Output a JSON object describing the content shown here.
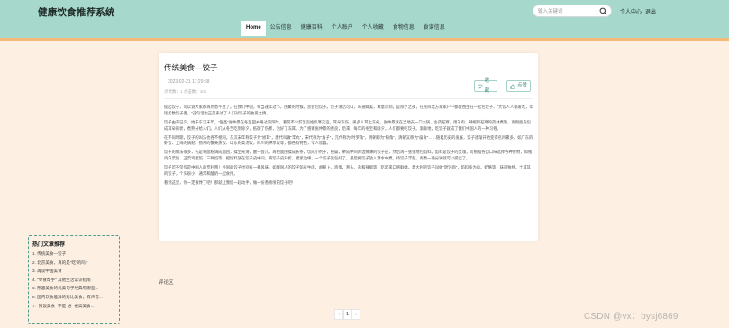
{
  "header": {
    "site_title": "健康饮食推荐系统",
    "search_placeholder": "输入关键词",
    "personal_center": "个人中心",
    "logout": "退出",
    "nav": [
      "Home",
      "公告信息",
      "健康百科",
      "个人账户",
      "个人收藏",
      "食物信息",
      "食谱信息"
    ]
  },
  "article": {
    "title": "传统美食—饺子",
    "date": "2023-02-21 17:29:58",
    "meta": "点赞数：1    点击数：101",
    "collect_label": "收藏",
    "like_label": "点赞",
    "paragraphs": [
      "提起饺子，可以说大家都再熟悉不过了。在我们中国，每当逢年过节，团聚的时候，总会包饺子。饺子清洁可口，味道鲜美，寓意深刻，是除夕之夜，在民间北方家家户户都会围坐在一起包饺子、\"大饺人人都爱吃，年饭尤数饺子香。\"这句话也正是表达了人们对饺子的独爱之情。",
      "饺子由来已久。始于东汉末年。\"医圣\"张仲景在冬至回乡路过南阳时，看见不少贫苦百姓饥寒交迫，耳朵冻伤，很多人耳上冻疮。张仲景就在当地支一口大锅，舍药祛寒。用羊肉、辣椒和祛寒的药材煮熟，再用面皮包成耳朵形状，煮熟分给人们。人们从冬至吃到除夕，抵御了伤寒，治好了冻耳。为了感谢张仲景的善良，后来，每年的冬至和除夕，人们都要吃饺子。渐渐地，吃饺子就成了我们中国人的一种习俗。",
      "在不同时期，饺子的叫法也各不相同。东汉末年称饺子为\"娇耳\"，唐代叫做\"牢丸\"，宋代称为\"角子\"，元代称为\"时罗角\"，明朝称为\"粉角\"，清朝又称为\"扁食\"……随着历史的发展，饺子逐渐开始变得名目繁多。如广东的虾饺、上海的锅贴、扬州的蟹黄蒸饺、山东的高汤饺，四川的钟水饺等，都各有特色，令人欣喜。",
      "饺子的做法很多，先是将面粉调成面团，揉至光滑，醒一会儿，再把面团揉成长条，切成小剂子，按扁，擀成中间厚边缘薄的饺子皮，然后再一张张地包馅料。馅料是饺子的灵魂，可根据各自口味选择各种食材，如猪肉白菜馅、韭菜鸡蛋馅、三鲜馅等。把馅料放在饺子皮中间，将饺子皮对折，捏紧边缘，一个饺子就包好了。最后把饺子放入沸水中煮，待饺子浮起，再煮一两分钟就可以捞出了。",
      "饺子可不仅仅是中国人的专利哦！外国的饺子也别有一番风味。如俄国人的饺子馅有牛肉、胡萝卜、鸡蛋、葱头、盐和辣椒等，吃起来口感鲜嫩。意大利的饺子叫做\"馄饨面\"，馅料多为肉、奶酪等，味道独特。土耳其的饺子，个头很小，通常和酸奶一起食用。",
      "看到这里，你一定很馋了吧！那就让我们一起动手，做一份香喷喷的饺子吧！"
    ]
  },
  "sidebar": {
    "title": "热门文章推荐",
    "items": [
      "1. 传统美食—饺子",
      "2. 北京美食，真的是\"吃\"的吗?",
      "3. 再谈中国美食",
      "4. \"零食帮手\" 其他生活常识指南",
      "5. 形容美食的优美句子经典有哪些...",
      "6. 国内饮食差异的对比美食，有声音...",
      "7. \"猪饭美食\" 不是\"进\" 被高美食..."
    ]
  },
  "comments": {
    "label": "评论区"
  },
  "pager": {
    "prev": "‹",
    "current": "1",
    "next": "›"
  },
  "watermark": "CSDN @vx：bysj6869",
  "colors": {
    "header_bg": "#a6d8cb",
    "page_bg": "#fdf0e2",
    "accent": "#3e8c80",
    "strip": "#f4b978"
  }
}
